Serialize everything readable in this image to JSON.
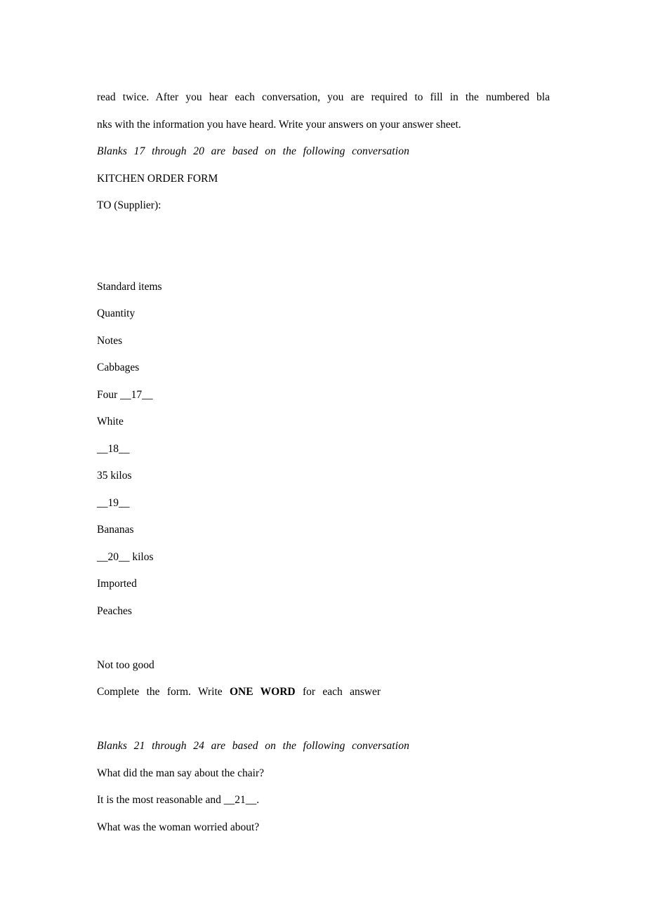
{
  "document": {
    "intro": {
      "line1": "read twice. After you hear each conversation, you are required to fill in the numbered bla",
      "line2": "nks with the information you have heard. Write your answers on your answer sheet."
    },
    "section_one": {
      "heading": "Blanks 17 through 20 are based on the following conversation",
      "form_title": "KITCHEN ORDER FORM",
      "supplier_label": "TO (Supplier):",
      "column_headers": [
        "Standard items",
        "Quantity",
        "Notes"
      ],
      "rows": [
        "Cabbages",
        "Four __17__",
        "White",
        "__18__",
        "35 kilos",
        "__19__",
        "Bananas",
        "__20__ kilos",
        "Imported",
        "Peaches",
        "Not too good"
      ],
      "instruction": {
        "before": "Complete the form. Write",
        "emphasis": "ONE WORD",
        "after": "for each answer"
      }
    },
    "section_two": {
      "heading": "Blanks 21 through 24 are based on the following conversation",
      "questions": [
        "What did the man say about the chair?",
        "It is the most reasonable and __21__.",
        "What was the woman worried about?"
      ]
    }
  }
}
